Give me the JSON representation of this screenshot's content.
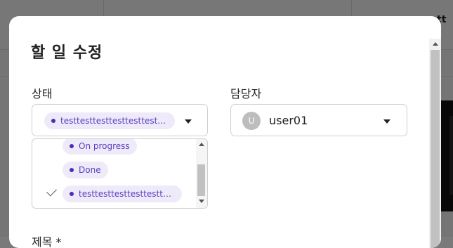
{
  "background": {
    "peek_text": "tt"
  },
  "modal": {
    "title": "할 일 수정",
    "status": {
      "label": "상태",
      "selected": "testtesttesttesttesttesttest…",
      "options": [
        {
          "label": "On progress",
          "checked": false
        },
        {
          "label": "Done",
          "checked": false
        },
        {
          "label": "testtesttesttesttesttestt…",
          "checked": true
        }
      ]
    },
    "assignee": {
      "label": "담당자",
      "avatar_initial": "U",
      "value": "user01"
    },
    "memo": {
      "label": "제목 *"
    }
  },
  "colors": {
    "chip_bg": "#efeafa",
    "chip_text": "#5a3fbf",
    "chip_dot": "#4a2fb0",
    "overlay": "rgba(0,0,0,0.52)"
  }
}
